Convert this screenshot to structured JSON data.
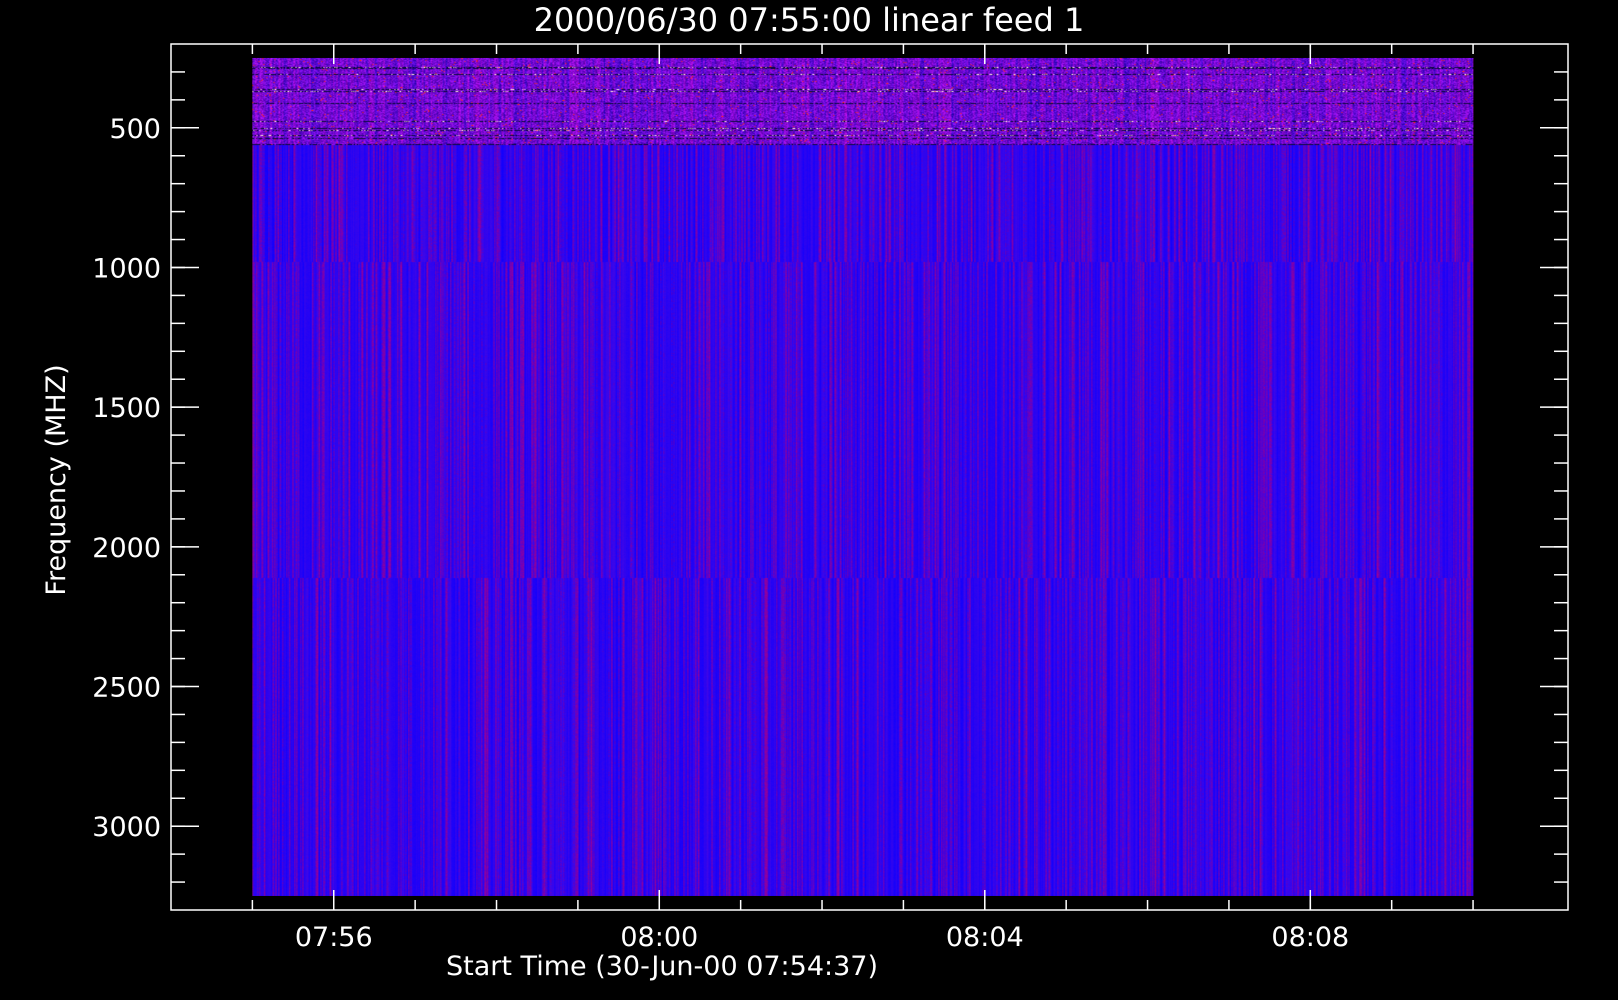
{
  "chart_data": {
    "type": "heatmap",
    "title": "2000/06/30 07:55:00 linear feed 1",
    "xlabel": "Start Time (30-Jun-00 07:54:37)",
    "ylabel": "Frequency (MHZ)",
    "x_ticks": [
      {
        "label": "07:56",
        "minutes": 56
      },
      {
        "label": "08:00",
        "minutes": 60
      },
      {
        "label": "08:04",
        "minutes": 64
      },
      {
        "label": "08:08",
        "minutes": 68
      }
    ],
    "y_ticks": [
      500,
      1000,
      1500,
      2000,
      2500,
      3000
    ],
    "xlim": [
      "07:54:00",
      "08:11:10"
    ],
    "ylim": [
      3300,
      200
    ],
    "data_extent": {
      "x": [
        "07:55:00",
        "08:10:00"
      ],
      "y": [
        250,
        3250
      ]
    },
    "frequency_bands_mhz": [
      [
        250,
        560
      ],
      [
        560,
        980
      ],
      [
        980,
        2110
      ],
      [
        2110,
        3250
      ]
    ],
    "colormap": [
      "#000000",
      "#1a00ff",
      "#0000ff",
      "#3a00e6",
      "#8a0090",
      "#ff2000",
      "#ffffff"
    ],
    "background": "#000000",
    "axis_color": "#ffffff"
  }
}
